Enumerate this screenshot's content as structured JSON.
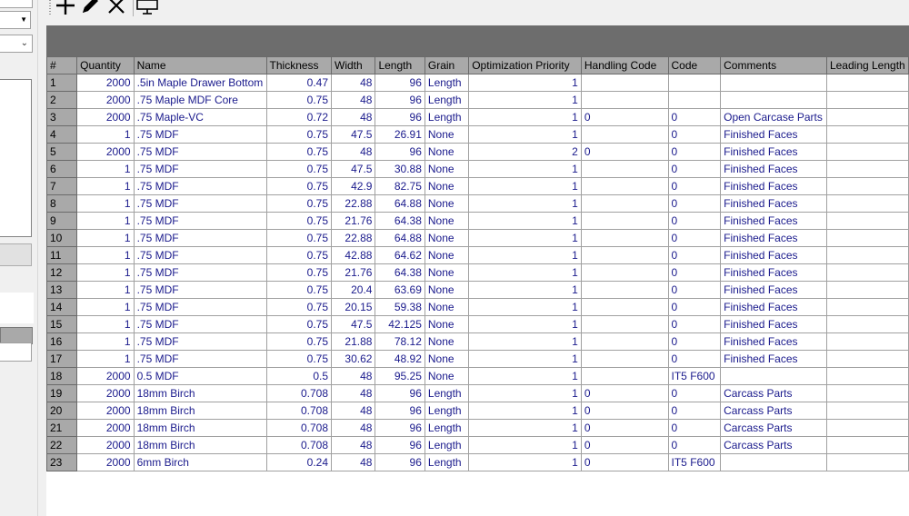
{
  "toolbar": {
    "icons": [
      "add-icon",
      "edit-icon",
      "delete-icon",
      "monitor-icon"
    ]
  },
  "grid": {
    "columns": [
      "#",
      "Quantity",
      "Name",
      "Thickness",
      "Width",
      "Length",
      "Grain",
      "Optimization Priority",
      "Handling Code",
      "Code",
      "Comments",
      "Leading Length"
    ],
    "rows": [
      [
        "1",
        "2000",
        ".5in Maple Drawer Bottom",
        "0.47",
        "48",
        "96",
        "Length",
        "1",
        "",
        "",
        "",
        ""
      ],
      [
        "2",
        "2000",
        ".75 Maple MDF Core",
        "0.75",
        "48",
        "96",
        "Length",
        "1",
        "",
        "",
        "",
        ""
      ],
      [
        "3",
        "2000",
        ".75 Maple-VC",
        "0.72",
        "48",
        "96",
        "Length",
        "1",
        "0",
        "0",
        "Open Carcase Parts",
        ""
      ],
      [
        "4",
        "1",
        ".75 MDF",
        "0.75",
        "47.5",
        "26.91",
        "None",
        "1",
        "",
        "0",
        "Finished Faces",
        ""
      ],
      [
        "5",
        "2000",
        ".75 MDF",
        "0.75",
        "48",
        "96",
        "None",
        "2",
        "0",
        "0",
        "Finished Faces",
        ""
      ],
      [
        "6",
        "1",
        ".75 MDF",
        "0.75",
        "47.5",
        "30.88",
        "None",
        "1",
        "",
        "0",
        "Finished Faces",
        ""
      ],
      [
        "7",
        "1",
        ".75 MDF",
        "0.75",
        "42.9",
        "82.75",
        "None",
        "1",
        "",
        "0",
        "Finished Faces",
        ""
      ],
      [
        "8",
        "1",
        ".75 MDF",
        "0.75",
        "22.88",
        "64.88",
        "None",
        "1",
        "",
        "0",
        "Finished Faces",
        ""
      ],
      [
        "9",
        "1",
        ".75 MDF",
        "0.75",
        "21.76",
        "64.38",
        "None",
        "1",
        "",
        "0",
        "Finished Faces",
        ""
      ],
      [
        "10",
        "1",
        ".75 MDF",
        "0.75",
        "22.88",
        "64.88",
        "None",
        "1",
        "",
        "0",
        "Finished Faces",
        ""
      ],
      [
        "11",
        "1",
        ".75 MDF",
        "0.75",
        "42.88",
        "64.62",
        "None",
        "1",
        "",
        "0",
        "Finished Faces",
        ""
      ],
      [
        "12",
        "1",
        ".75 MDF",
        "0.75",
        "21.76",
        "64.38",
        "None",
        "1",
        "",
        "0",
        "Finished Faces",
        ""
      ],
      [
        "13",
        "1",
        ".75 MDF",
        "0.75",
        "20.4",
        "63.69",
        "None",
        "1",
        "",
        "0",
        "Finished Faces",
        ""
      ],
      [
        "14",
        "1",
        ".75 MDF",
        "0.75",
        "20.15",
        "59.38",
        "None",
        "1",
        "",
        "0",
        "Finished Faces",
        ""
      ],
      [
        "15",
        "1",
        ".75 MDF",
        "0.75",
        "47.5",
        "42.125",
        "None",
        "1",
        "",
        "0",
        "Finished Faces",
        ""
      ],
      [
        "16",
        "1",
        ".75 MDF",
        "0.75",
        "21.88",
        "78.12",
        "None",
        "1",
        "",
        "0",
        "Finished Faces",
        ""
      ],
      [
        "17",
        "1",
        ".75 MDF",
        "0.75",
        "30.62",
        "48.92",
        "None",
        "1",
        "",
        "0",
        "Finished Faces",
        ""
      ],
      [
        "18",
        "2000",
        "0.5 MDF",
        "0.5",
        "48",
        "95.25",
        "None",
        "1",
        "",
        "IT5 F600",
        "",
        ""
      ],
      [
        "19",
        "2000",
        "18mm Birch",
        "0.708",
        "48",
        "96",
        "Length",
        "1",
        "0",
        "0",
        "Carcass Parts",
        ""
      ],
      [
        "20",
        "2000",
        "18mm Birch",
        "0.708",
        "48",
        "96",
        "Length",
        "1",
        "0",
        "0",
        "Carcass Parts",
        ""
      ],
      [
        "21",
        "2000",
        "18mm Birch",
        "0.708",
        "48",
        "96",
        "Length",
        "1",
        "0",
        "0",
        "Carcass Parts",
        ""
      ],
      [
        "22",
        "2000",
        "18mm Birch",
        "0.708",
        "48",
        "96",
        "Length",
        "1",
        "0",
        "0",
        "Carcass Parts",
        ""
      ],
      [
        "23",
        "2000",
        "6mm Birch",
        "0.24",
        "48",
        "96",
        "Length",
        "1",
        "0",
        "IT5 F600",
        "",
        ""
      ]
    ]
  },
  "colors": {
    "header_bg": "#a9a9a9",
    "band_bg": "#6d6d6d",
    "cell_text": "#1a1a8c"
  }
}
